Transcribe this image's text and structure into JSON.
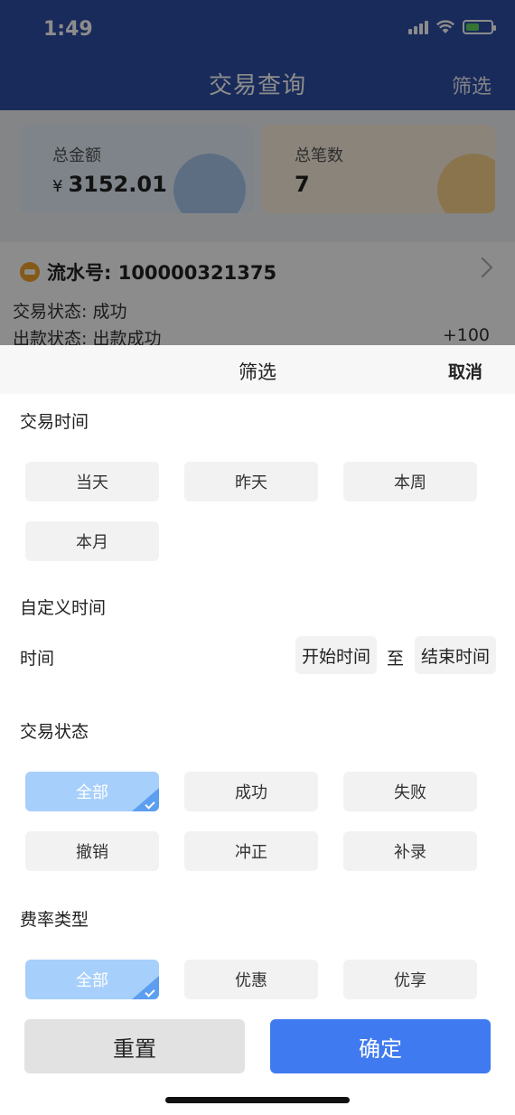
{
  "status_bar": {
    "time": "1:49"
  },
  "nav": {
    "title": "交易查询",
    "filter_label": "筛选"
  },
  "summary": {
    "amount_label": "总金额",
    "amount_currency": "¥",
    "amount_value": "3152.01",
    "count_label": "总笔数",
    "count_value": "7"
  },
  "record": {
    "serial": "流水号: 100000321375",
    "status_line": "交易状态: 成功",
    "payout_line": "出款状态: 出款成功",
    "amount": "+100"
  },
  "sheet": {
    "title": "筛选",
    "cancel_label": "取消",
    "trade_time": {
      "title": "交易时间",
      "options": [
        "当天",
        "昨天",
        "本周",
        "本月"
      ]
    },
    "custom_time": {
      "title": "自定义时间",
      "row_label": "时间",
      "start_label": "开始时间",
      "separator": "至",
      "end_label": "结束时间"
    },
    "trade_status": {
      "title": "交易状态",
      "options": [
        "全部",
        "成功",
        "失败",
        "撤销",
        "冲正",
        "补录"
      ],
      "selected": "全部"
    },
    "fee_type": {
      "title": "费率类型",
      "options": [
        "全部",
        "优惠",
        "优享"
      ],
      "selected": "全部"
    },
    "reset_label": "重置",
    "confirm_label": "确定"
  },
  "colors": {
    "nav_bg": "#2f4fa6",
    "chip_active": "#a7cffb",
    "confirm_bg": "#3f7af0"
  }
}
